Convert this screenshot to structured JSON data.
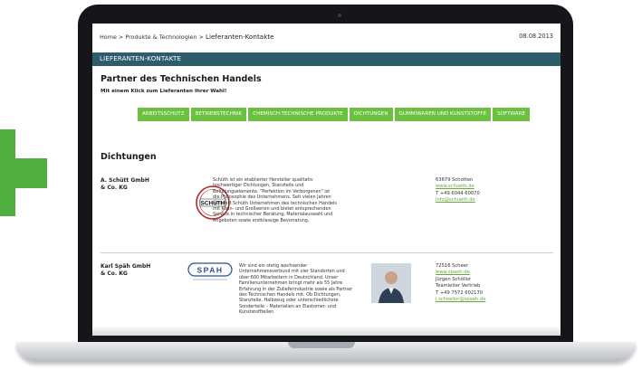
{
  "topbar": {
    "breadcrumb": [
      "Home",
      "Produkte & Technologien",
      "Lieferanten-Kontakte"
    ],
    "separator": ">",
    "date": "08.08.2013"
  },
  "section_bar": "LIEFERANTEN-KONTAKTE",
  "page": {
    "title": "Partner des Technischen Handels",
    "subtitle": "Mit einem Klick zum Lieferanten Ihrer Wahl!"
  },
  "filters": [
    "ARBEITSSCHUTZ",
    "BETRIEBSTECHNIK",
    "CHEMISCH-TECHNISCHE PRODUKTE",
    "DICHTUNGEN",
    "GUMMIWAREN UND KUNSTSTOFFE",
    "SOFTWARE"
  ],
  "category_title": "Dichtungen",
  "entries": [
    {
      "name": "A. Schütt GmbH & Co. KG",
      "logo_text": "SCHÜTH",
      "description": "Schüth ist ein etablierter Hersteller qualitativ hochwertiger Dichtungen, Stanzteile und Befüllungselemente. \"Perfektion im Verborgenen\" ist die Philosophie des Unternehmens. Seit vielen Jahren beliefert Schüth Unternehmen des technischen Handels mit Klein- und Großserien und bietet entsprechenden Service in technischer Beratung, Materialauswahl und Angeboten sowie erstklassige Bevorratung.",
      "contact": {
        "city": "63679 Schotten",
        "website": "www.schueth.de",
        "phone": "T +49 6044 60070",
        "email": "info@schueth.de"
      }
    },
    {
      "name": "Karl Späh GmbH & Co. KG",
      "logo_text": "SPAH",
      "description": "Wir sind ein stetig wachsender Unternehmensverbund mit vier Standorten und über 600 Mitarbeitern in Deutschland. Unser Familienunternehmen bringt mehr als 55 Jahre Erfahrung in der Zulieferindustrie sowie als Partner des Technischen Handels mit. Ob Dichtungen, Stanzteile, Halbzeug oder unterschiedlichste Sonderteile – Materialien an Elastomer- und Kunststoffteilen",
      "contact": {
        "city": "72516 Scheer",
        "website": "www.spaeh.de",
        "person": "Jürgen Schöllor",
        "role": "Teamleiter Vertrieb",
        "phone": "T +49 7572 602170",
        "email": "j.schoellor@spaeh.de"
      }
    }
  ],
  "colors": {
    "accent_green": "#6cc03f",
    "header_teal": "#2d5d6b",
    "plus_green": "#4fae3f"
  }
}
